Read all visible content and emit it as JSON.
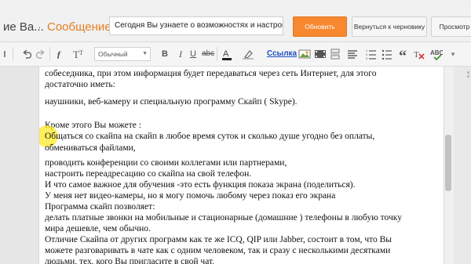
{
  "header": {
    "blog_name": "ие Ва...",
    "separator": "·",
    "section": "Сообщение",
    "post_title": "Сегодня Вы узнаете о  возможностях  и настройк",
    "publish_label": "Обновить",
    "revert_label": "Вернуться к черновику",
    "preview_label": "Просмотр"
  },
  "toolbar": {
    "font_format": "Обычный",
    "link_label": "Ссылка"
  },
  "editor": {
    "lines": [
      "собеседника, при этом информация будет передаваться через сеть Интернет, для этого",
      "достаточно иметь:",
      "наушники, веб-камеру и специальную программу Скайп ( Skype).",
      "",
      "Кроме этого Вы можете :",
      "Общаться со скайпа на скайп в любое время суток и сколько душе угодно без оплаты,",
      "обмениваться файлами,",
      "проводить конференции со своими коллегами или партнерами,",
      "настроить переадресацию со скайпа на свой телефон.",
      "И что самое важное для обучения -это есть функция показа экрана (поделиться).",
      "У меня нет видео-камеры, но я могу помочь любому через показ его экрана",
      "Программа скайп позволяет:",
      "делать платные звонки на мобильные и стационарные (домашние ) телефоны в любую точку",
      "мира дешевле, чем обычно.",
      "Отличие Скайпа от других программ как те же ICQ, QIP или Jabber, состоит в том, что Вы",
      "можете разговаривать в чате как с одним человеком, так и сразу с несколькими десятками",
      "людьми, тех, кого Вы пригласите в свой чат."
    ]
  }
}
